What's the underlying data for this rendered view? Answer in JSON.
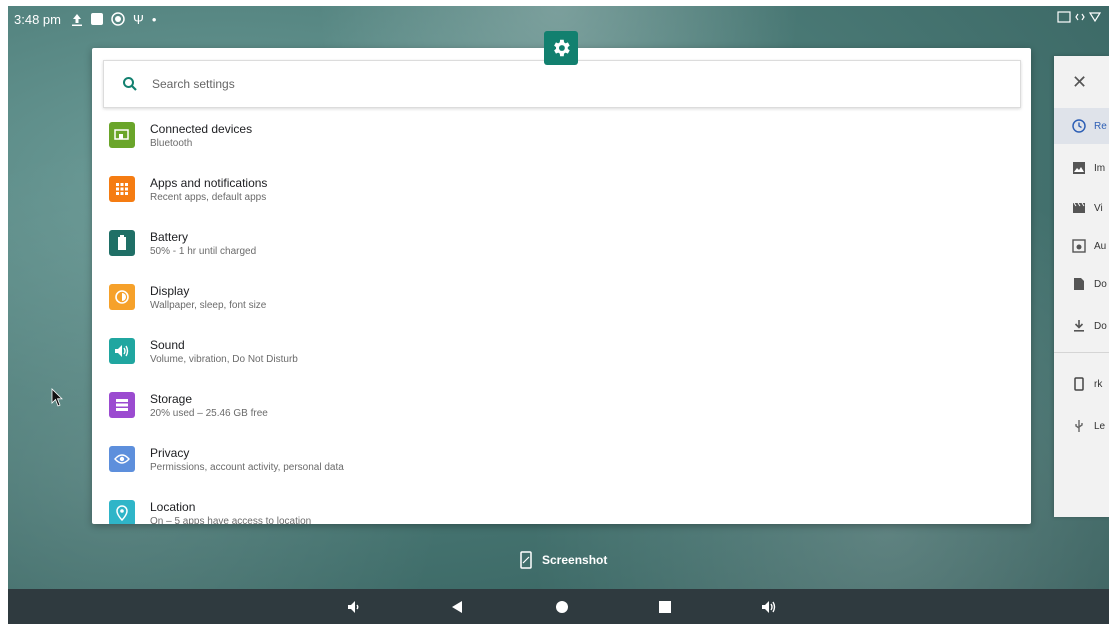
{
  "status_bar": {
    "time": "3:48 pm"
  },
  "search": {
    "placeholder": "Search settings"
  },
  "settings_items": [
    {
      "title": "Connected devices",
      "subtitle": "Bluetooth",
      "icon": "connected-devices-icon",
      "color": "#6aa52a"
    },
    {
      "title": "Apps and notifications",
      "subtitle": "Recent apps, default apps",
      "icon": "apps-icon",
      "color": "#f57c12"
    },
    {
      "title": "Battery",
      "subtitle": "50% - 1 hr until charged",
      "icon": "battery-icon",
      "color": "#1f6f66"
    },
    {
      "title": "Display",
      "subtitle": "Wallpaper, sleep, font size",
      "icon": "display-icon",
      "color": "#f6a12a"
    },
    {
      "title": "Sound",
      "subtitle": "Volume, vibration, Do Not Disturb",
      "icon": "sound-icon",
      "color": "#20a6a0"
    },
    {
      "title": "Storage",
      "subtitle": "20% used – 25.46 GB free",
      "icon": "storage-icon",
      "color": "#9b4bd0"
    },
    {
      "title": "Privacy",
      "subtitle": "Permissions, account activity, personal data",
      "icon": "privacy-icon",
      "color": "#5d8fdc"
    },
    {
      "title": "Location",
      "subtitle": "On – 5 apps have access to location",
      "icon": "location-icon",
      "color": "#2fb5c8"
    }
  ],
  "side_sheet": {
    "items": [
      {
        "label": "Re",
        "icon": "recent-icon"
      },
      {
        "label": "Im",
        "icon": "images-icon"
      },
      {
        "label": "Vi",
        "icon": "videos-icon"
      },
      {
        "label": "Au",
        "icon": "audio-icon"
      },
      {
        "label": "Do",
        "icon": "documents-icon"
      },
      {
        "label": "Do",
        "icon": "downloads-icon"
      },
      {
        "label": "rk",
        "icon": "phone-icon"
      },
      {
        "label": "Le",
        "icon": "usb-icon"
      }
    ]
  },
  "screenshot_label": "Screenshot",
  "colors": {
    "accent": "#12806f",
    "navbar": "#2f3a3f",
    "active_blue": "#2d5fb5"
  }
}
